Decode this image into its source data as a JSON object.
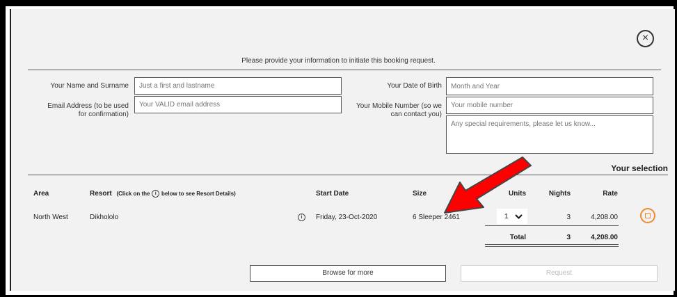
{
  "modal": {
    "close_icon": "×",
    "intro": "Please provide your information to initiate this booking request."
  },
  "form": {
    "name_label": "Your Name and Surname",
    "name_placeholder": "Just a first and lastname",
    "email_label_1": "Email Address (to be used",
    "email_label_2": "for confirmation)",
    "email_placeholder": "Your VALID email address",
    "dob_label": "Your Date of Birth",
    "dob_placeholder": "Month and Year",
    "mobile_label_1": "Your Mobile Number (so we",
    "mobile_label_2": "can contact you)",
    "mobile_placeholder": "Your mobile number",
    "requirements_placeholder": "Any special requirements, please let us know..."
  },
  "selection": {
    "title": "Your selection",
    "headers": {
      "area": "Area",
      "resort": "Resort",
      "resort_note_pre": "(Click on the",
      "resort_note_post": "below to see Resort Details)",
      "start_date": "Start Date",
      "size": "Size",
      "units": "Units",
      "nights": "Nights",
      "rate": "Rate"
    },
    "row": {
      "area": "North West",
      "resort": "Dikhololo",
      "start_date": "Friday, 23-Oct-2020",
      "size": "6 Sleeper 2461",
      "units": "1",
      "nights": "3",
      "rate": "4,208.00"
    },
    "total": {
      "label": "Total",
      "nights": "3",
      "rate": "4,208.00"
    }
  },
  "buttons": {
    "browse": "Browse for more",
    "request": "Request"
  },
  "colors": {
    "annotation_arrow": "#ff0000",
    "trash_icon": "#f08a2e"
  }
}
